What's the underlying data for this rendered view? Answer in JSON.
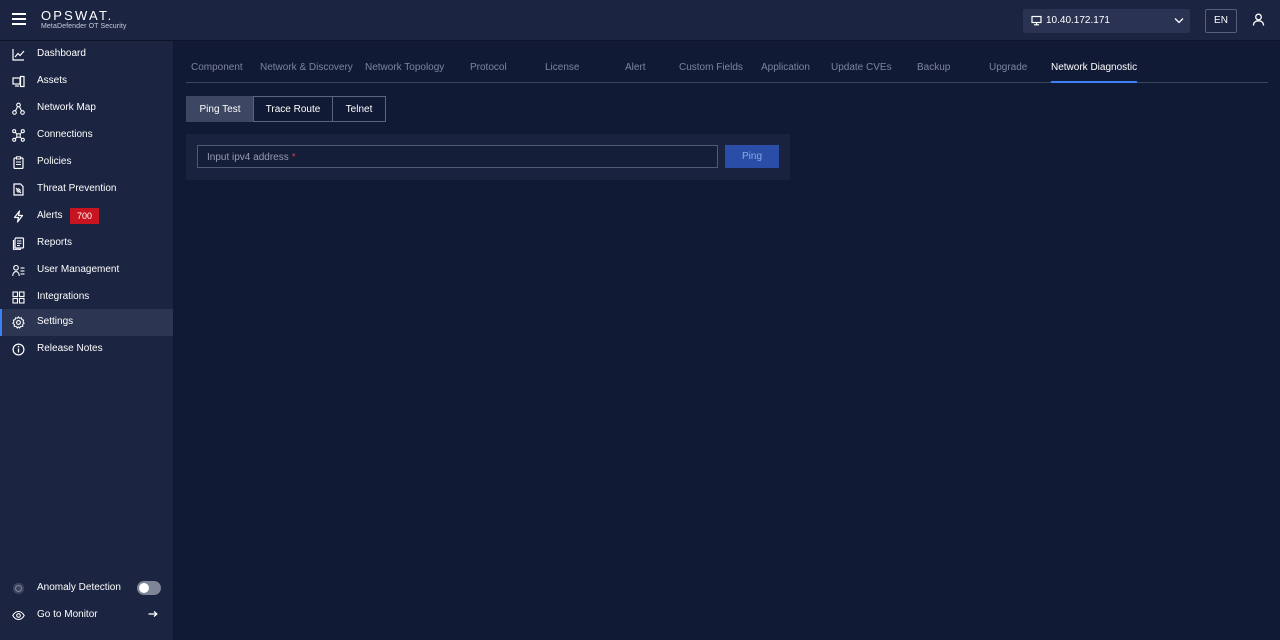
{
  "header": {
    "logo_text": "OPSWAT.",
    "logo_subtitle": "MetaDefender OT Security",
    "ip_address": "10.40.172.171",
    "language": "EN"
  },
  "sidebar": {
    "items": [
      {
        "label": "Dashboard",
        "icon": "chart-line-icon"
      },
      {
        "label": "Assets",
        "icon": "devices-icon"
      },
      {
        "label": "Network Map",
        "icon": "network-map-icon"
      },
      {
        "label": "Connections",
        "icon": "connections-icon"
      },
      {
        "label": "Policies",
        "icon": "clipboard-icon"
      },
      {
        "label": "Threat Prevention",
        "icon": "threat-doc-icon"
      },
      {
        "label": "Alerts",
        "icon": "lightning-icon",
        "badge": "700"
      },
      {
        "label": "Reports",
        "icon": "reports-icon"
      },
      {
        "label": "User Management",
        "icon": "user-list-icon"
      },
      {
        "label": "Integrations",
        "icon": "integrations-icon"
      },
      {
        "label": "Settings",
        "icon": "gear-icon",
        "active": true
      },
      {
        "label": "Release Notes",
        "icon": "info-icon"
      }
    ],
    "bottom": {
      "anomaly_label": "Anomaly Detection",
      "anomaly_enabled": false,
      "monitor_label": "Go to Monitor"
    }
  },
  "settings_tabs": [
    {
      "label": "Component"
    },
    {
      "label": "Network & Discovery"
    },
    {
      "label": "Network Topology"
    },
    {
      "label": "Protocol"
    },
    {
      "label": "License"
    },
    {
      "label": "Alert"
    },
    {
      "label": "Custom Fields"
    },
    {
      "label": "Application"
    },
    {
      "label": "Update CVEs"
    },
    {
      "label": "Backup"
    },
    {
      "label": "Upgrade"
    },
    {
      "label": "Network Diagnostic",
      "active": true
    }
  ],
  "diagnostic_tabs": [
    {
      "label": "Ping Test",
      "active": true
    },
    {
      "label": "Trace Route"
    },
    {
      "label": "Telnet"
    }
  ],
  "ping": {
    "input_placeholder": "Input ipv4 address",
    "required_mark": "*",
    "button_label": "Ping"
  },
  "colors": {
    "background": "#111a35",
    "sidebar": "#1b2440",
    "accent": "#3b82f6",
    "badge": "#c81420",
    "ping_button": "#2a4ea8"
  }
}
